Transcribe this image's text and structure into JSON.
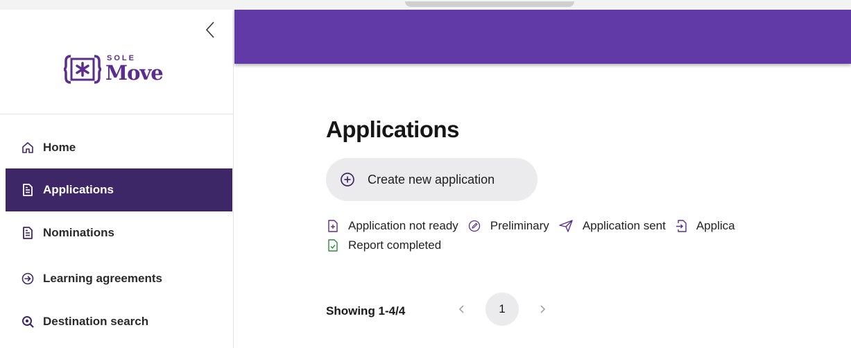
{
  "brand": {
    "sup": "SOLE",
    "name": "Move",
    "color": "#5b2d8e"
  },
  "sidebar": {
    "items": [
      {
        "label": "Home",
        "icon": "home-icon",
        "active": false
      },
      {
        "label": "Applications",
        "icon": "document-icon",
        "active": true
      },
      {
        "label": "Nominations",
        "icon": "document-icon",
        "active": false
      },
      {
        "label": "Learning agreements",
        "icon": "arrow-circle-icon",
        "active": false
      },
      {
        "label": "Destination search",
        "icon": "search-globe-icon",
        "active": false
      }
    ],
    "active_color": "#3e2766"
  },
  "banner": {
    "color": "#623aa8"
  },
  "main": {
    "title": "Applications",
    "create_button_label": "Create new application",
    "legend": [
      {
        "label": "Application not ready",
        "icon": "file-plus-icon",
        "color": "#5b2d8e"
      },
      {
        "label": "Preliminary",
        "icon": "pencil-circle-icon",
        "color": "#5b2d8e"
      },
      {
        "label": "Application sent",
        "icon": "send-icon",
        "color": "#5b2d8e"
      },
      {
        "label": "Applica",
        "icon": "file-import-icon",
        "color": "#5b2d8e"
      },
      {
        "label": "Report completed",
        "icon": "file-check-icon",
        "color": "#2e8b3e"
      }
    ],
    "pagination": {
      "showing": "Showing 1-4/4",
      "current_page": "1"
    }
  }
}
